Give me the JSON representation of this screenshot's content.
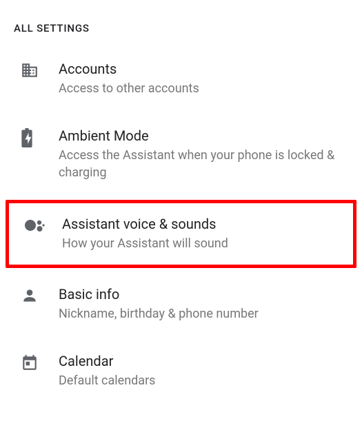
{
  "header": "ALL SETTINGS",
  "items": [
    {
      "icon": "business-icon",
      "title": "Accounts",
      "subtitle": "Access to other accounts",
      "highlighted": false
    },
    {
      "icon": "battery-icon",
      "title": "Ambient Mode",
      "subtitle": "Access the Assistant when your phone is locked & charging",
      "highlighted": false
    },
    {
      "icon": "assistant-icon",
      "title": "Assistant voice & sounds",
      "subtitle": "How your Assistant will sound",
      "highlighted": true
    },
    {
      "icon": "person-icon",
      "title": "Basic info",
      "subtitle": "Nickname, birthday & phone number",
      "highlighted": false
    },
    {
      "icon": "calendar-icon",
      "title": "Calendar",
      "subtitle": "Default calendars",
      "highlighted": false
    }
  ]
}
